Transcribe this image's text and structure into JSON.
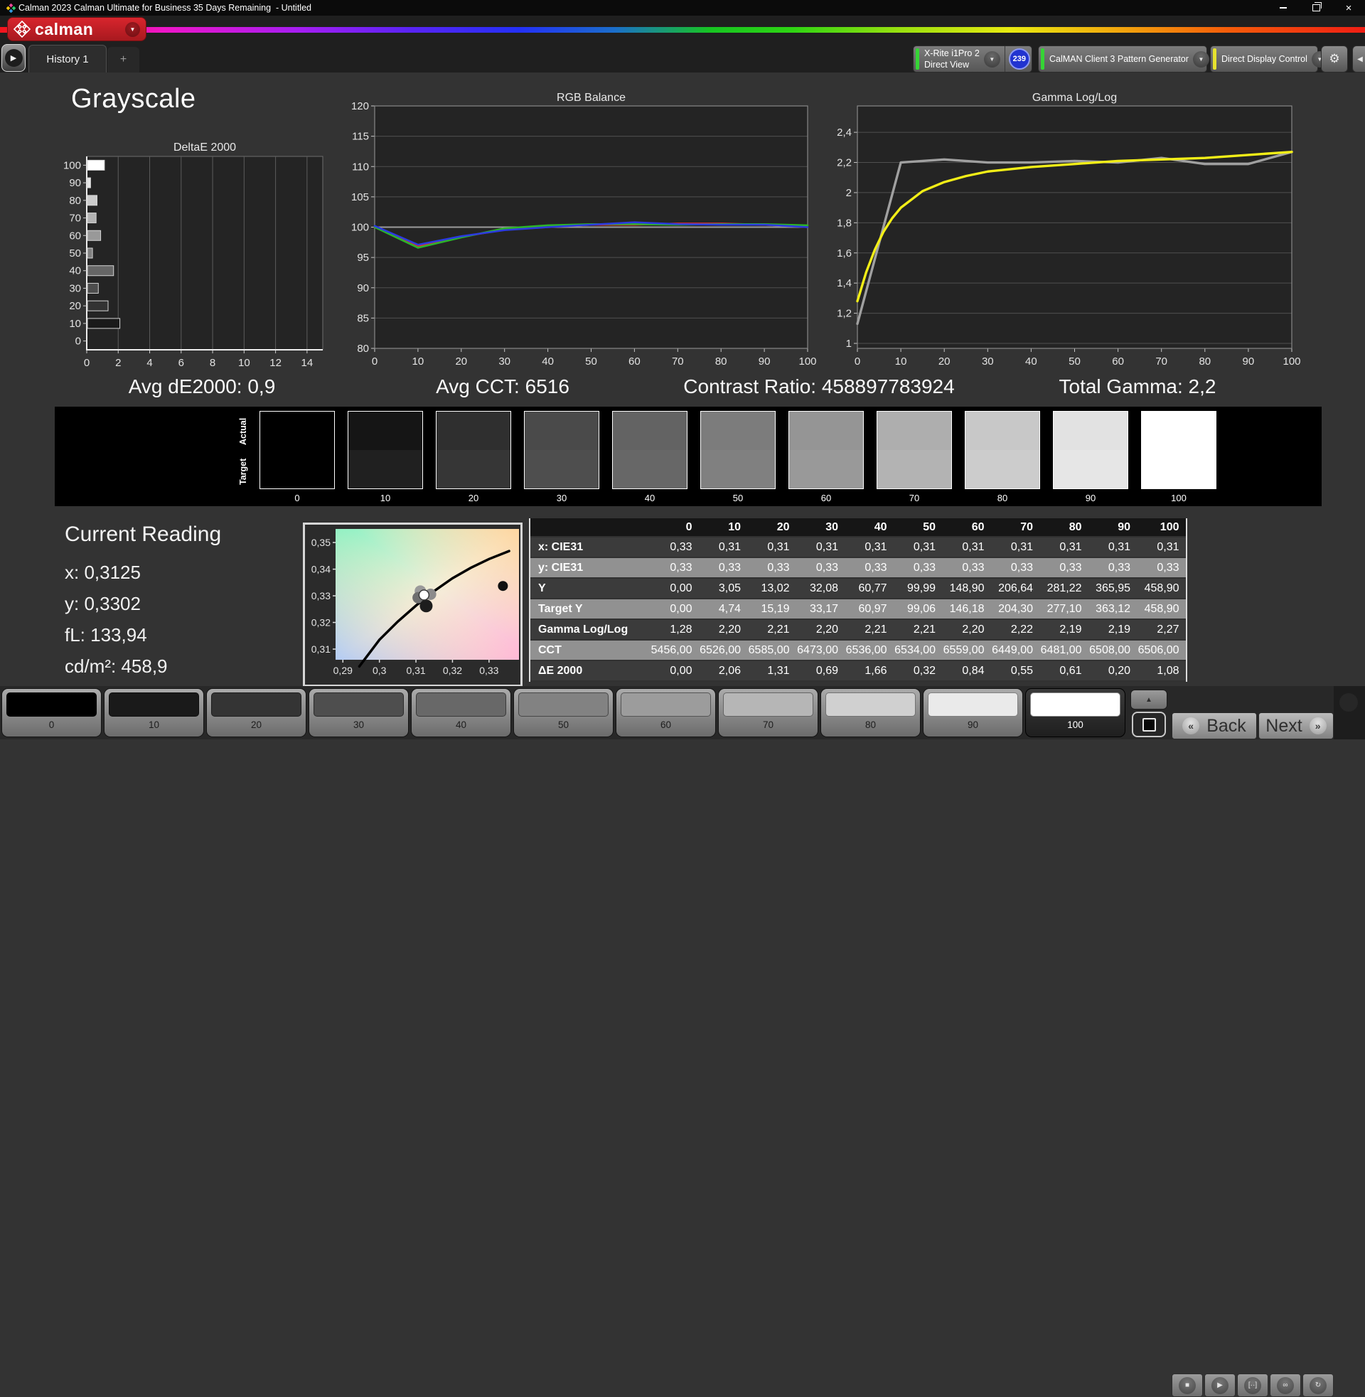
{
  "window": {
    "title": "Calman 2023 Calman Ultimate for Business 35 Days Remaining  - Untitled"
  },
  "brand": {
    "logo_text": "calman",
    "chevron": "▼"
  },
  "tab_bar": {
    "expander_icon": "▶",
    "tabs": [
      {
        "label": "History 1"
      },
      {
        "label": "+"
      }
    ]
  },
  "toolbar": {
    "chevron": "▼",
    "meter": {
      "line1": "X-Rite i1Pro 2",
      "line2": "Direct View",
      "badge": "239",
      "accent": "#35d435"
    },
    "generator": {
      "label": "CalMAN Client 3 Pattern Generator",
      "accent": "#35d435"
    },
    "display_control": {
      "label": "Direct Display Control",
      "accent": "#e6e22e"
    },
    "gear_icon": "⚙",
    "edge_icon": "◀"
  },
  "page": {
    "title": "Grayscale"
  },
  "stats": {
    "avg_de": "Avg dE2000: 0,9",
    "avg_cct": "Avg CCT: 6516",
    "contrast": "Contrast Ratio: 458897783924",
    "total_gamma": "Total Gamma: 2,2"
  },
  "chart_data": [
    {
      "id": "deltae",
      "type": "bar",
      "orientation": "horizontal",
      "title": "DeltaE 2000",
      "categories": [
        "100",
        "90",
        "80",
        "70",
        "60",
        "50",
        "40",
        "30",
        "20",
        "10",
        "0"
      ],
      "values": [
        1.08,
        0.2,
        0.61,
        0.55,
        0.84,
        0.32,
        1.66,
        0.69,
        1.31,
        2.06,
        0.0
      ],
      "bar_colors": [
        "#ffffff",
        "#e6e6e6",
        "#cccccc",
        "#b3b3b3",
        "#999999",
        "#808080",
        "#666666",
        "#4d4d4d",
        "#333333",
        "#1a1a1a",
        "#000000"
      ],
      "xlim": [
        0,
        15
      ],
      "xticks": [
        0,
        2,
        4,
        6,
        8,
        10,
        12,
        14
      ],
      "grid": true
    },
    {
      "id": "rgb",
      "type": "line",
      "title": "RGB Balance",
      "x": [
        0,
        10,
        20,
        30,
        40,
        50,
        60,
        70,
        80,
        90,
        100
      ],
      "ylim": [
        80,
        120
      ],
      "yticks": [
        120,
        115,
        110,
        105,
        100,
        95,
        90,
        85,
        80
      ],
      "ref_y": 100,
      "series": [
        {
          "name": "red",
          "color": "#e03131",
          "values": [
            100,
            96.9,
            98.4,
            99.6,
            100.0,
            100.4,
            100.4,
            100.6,
            100.6,
            100.4,
            100.0
          ]
        },
        {
          "name": "green",
          "color": "#2bb42b",
          "values": [
            100,
            96.6,
            98.3,
            99.8,
            100.3,
            100.5,
            100.5,
            100.4,
            100.5,
            100.5,
            100.3
          ]
        },
        {
          "name": "blue",
          "color": "#2b3be0",
          "values": [
            100.2,
            97.1,
            98.5,
            99.5,
            100.0,
            100.4,
            100.8,
            100.5,
            100.4,
            100.4,
            100.0
          ]
        }
      ]
    },
    {
      "id": "gamma",
      "type": "line",
      "title": "Gamma Log/Log",
      "ylim": [
        0.967,
        2.575
      ],
      "yticks": [
        2.4,
        2.2,
        2.0,
        1.8,
        1.6,
        1.4,
        1.2,
        1.0
      ],
      "ytick_labels": [
        "2,4",
        "2,2",
        "2",
        "1,8",
        "1,6",
        "1,4",
        "1,2",
        "1"
      ],
      "xticks": [
        0,
        10,
        20,
        30,
        40,
        50,
        60,
        70,
        80,
        90,
        100
      ],
      "series": [
        {
          "name": "reference",
          "color": "#a0a0a0",
          "x": [
            0,
            10,
            20,
            30,
            40,
            50,
            60,
            70,
            80,
            90,
            100
          ],
          "values": [
            1.13,
            2.2,
            2.22,
            2.2,
            2.2,
            2.21,
            2.2,
            2.23,
            2.19,
            2.19,
            2.27
          ]
        },
        {
          "name": "measured",
          "color": "#f2ee17",
          "x": [
            0,
            2,
            4,
            6,
            8,
            10,
            15,
            20,
            25,
            30,
            40,
            50,
            60,
            70,
            80,
            90,
            100
          ],
          "values": [
            1.28,
            1.47,
            1.62,
            1.74,
            1.83,
            1.9,
            2.01,
            2.07,
            2.11,
            2.14,
            2.17,
            2.19,
            2.21,
            2.22,
            2.23,
            2.25,
            2.27
          ]
        }
      ]
    },
    {
      "id": "cie",
      "type": "scatter",
      "title": "CIE 1931 xy",
      "xlim": [
        0.288,
        0.3382
      ],
      "ylim": [
        0.306,
        0.3551
      ],
      "xticks": [
        0.29,
        0.3,
        0.31,
        0.32,
        0.33
      ],
      "xtick_labels": [
        "0,29",
        "0,3",
        "0,31",
        "0,32",
        "0,33"
      ],
      "yticks": [
        0.35,
        0.34,
        0.33,
        0.32,
        0.31
      ],
      "ytick_labels": [
        "0,35",
        "0,34",
        "0,33",
        "0,32",
        "0,31"
      ],
      "locus": [
        [
          0.2945,
          0.3035
        ],
        [
          0.3,
          0.3135
        ],
        [
          0.305,
          0.3203
        ],
        [
          0.31,
          0.3263
        ],
        [
          0.315,
          0.3318
        ],
        [
          0.32,
          0.3366
        ],
        [
          0.325,
          0.3405
        ],
        [
          0.33,
          0.3438
        ],
        [
          0.3355,
          0.3468
        ]
      ],
      "points": [
        {
          "x": 0.3112,
          "y": 0.3318,
          "r": 8,
          "fill": "#9a9a9a"
        },
        {
          "x": 0.314,
          "y": 0.3306,
          "r": 8,
          "fill": "#8b8b8b"
        },
        {
          "x": 0.3106,
          "y": 0.3293,
          "r": 8,
          "fill": "#6f6f6f"
        },
        {
          "x": 0.3128,
          "y": 0.3262,
          "r": 9,
          "fill": "#1d1d1d"
        },
        {
          "x": 0.3122,
          "y": 0.3303,
          "r": 7,
          "fill": "#ffffff",
          "stroke": "#3a3a3a"
        },
        {
          "x": 0.3338,
          "y": 0.3337,
          "r": 7,
          "fill": "#111111"
        }
      ]
    }
  ],
  "grayscale_strip": {
    "row_labels": [
      "Actual",
      "Target"
    ],
    "levels": [
      {
        "label": "0",
        "actual": "#000000",
        "target": "#000000"
      },
      {
        "label": "10",
        "actual": "#151515",
        "target": "#202020"
      },
      {
        "label": "20",
        "actual": "#2f2f2f",
        "target": "#363636"
      },
      {
        "label": "30",
        "actual": "#4a4a4a",
        "target": "#4e4e4e"
      },
      {
        "label": "40",
        "actual": "#636363",
        "target": "#676767"
      },
      {
        "label": "50",
        "actual": "#7c7c7c",
        "target": "#808080"
      },
      {
        "label": "60",
        "actual": "#959595",
        "target": "#999999"
      },
      {
        "label": "70",
        "actual": "#aeaeae",
        "target": "#b3b3b3"
      },
      {
        "label": "80",
        "actual": "#c8c8c8",
        "target": "#cccccc"
      },
      {
        "label": "90",
        "actual": "#e2e2e2",
        "target": "#e6e6e6"
      },
      {
        "label": "100",
        "actual": "#ffffff",
        "target": "#ffffff"
      }
    ]
  },
  "current_reading": {
    "title": "Current Reading",
    "lines": [
      "x: 0,3125",
      "y: 0,3302",
      "fL: 133,94",
      "cd/m²: 458,9"
    ]
  },
  "table": {
    "headers": [
      "",
      "0",
      "10",
      "20",
      "30",
      "40",
      "50",
      "60",
      "70",
      "80",
      "90",
      "100"
    ],
    "rows": [
      {
        "label": "x: CIE31",
        "shade": "dark",
        "values": [
          "0,33",
          "0,31",
          "0,31",
          "0,31",
          "0,31",
          "0,31",
          "0,31",
          "0,31",
          "0,31",
          "0,31",
          "0,31"
        ]
      },
      {
        "label": "y: CIE31",
        "shade": "light",
        "values": [
          "0,33",
          "0,33",
          "0,33",
          "0,33",
          "0,33",
          "0,33",
          "0,33",
          "0,33",
          "0,33",
          "0,33",
          "0,33"
        ]
      },
      {
        "label": "Y",
        "shade": "dark",
        "values": [
          "0,00",
          "3,05",
          "13,02",
          "32,08",
          "60,77",
          "99,99",
          "148,90",
          "206,64",
          "281,22",
          "365,95",
          "458,90"
        ]
      },
      {
        "label": "Target Y",
        "shade": "light",
        "values": [
          "0,00",
          "4,74",
          "15,19",
          "33,17",
          "60,97",
          "99,06",
          "146,18",
          "204,30",
          "277,10",
          "363,12",
          "458,90"
        ]
      },
      {
        "label": "Gamma Log/Log",
        "shade": "dark",
        "values": [
          "1,28",
          "2,20",
          "2,21",
          "2,20",
          "2,21",
          "2,21",
          "2,20",
          "2,22",
          "2,19",
          "2,19",
          "2,27"
        ]
      },
      {
        "label": "CCT",
        "shade": "light",
        "values": [
          "5456,00",
          "6526,00",
          "6585,00",
          "6473,00",
          "6536,00",
          "6534,00",
          "6559,00",
          "6449,00",
          "6481,00",
          "6508,00",
          "6506,00"
        ]
      },
      {
        "label": "ΔE 2000",
        "shade": "dark",
        "values": [
          "0,00",
          "2,06",
          "1,31",
          "0,69",
          "1,66",
          "0,32",
          "0,84",
          "0,55",
          "0,61",
          "0,20",
          "1,08"
        ]
      }
    ]
  },
  "patch_bar": {
    "patches": [
      {
        "label": "0",
        "color": "#000000"
      },
      {
        "label": "10",
        "color": "#1a1a1a"
      },
      {
        "label": "20",
        "color": "#343434"
      },
      {
        "label": "30",
        "color": "#4e4e4e"
      },
      {
        "label": "40",
        "color": "#686868"
      },
      {
        "label": "50",
        "color": "#828282"
      },
      {
        "label": "60",
        "color": "#9c9c9c"
      },
      {
        "label": "70",
        "color": "#b6b6b6"
      },
      {
        "label": "80",
        "color": "#d0d0d0"
      },
      {
        "label": "90",
        "color": "#eaeaea"
      },
      {
        "label": "100",
        "color": "#ffffff"
      }
    ],
    "selected": "100",
    "up_icon": "▲",
    "transport": [
      {
        "name": "stop",
        "glyph": "■"
      },
      {
        "name": "play",
        "glyph": "▶"
      },
      {
        "name": "pattern",
        "glyph": "[··]"
      },
      {
        "name": "infinite",
        "glyph": "∞"
      },
      {
        "name": "refresh",
        "glyph": "↻"
      }
    ],
    "nav": {
      "back": "Back",
      "next": "Next",
      "back_icon": "«",
      "next_icon": "»"
    }
  }
}
